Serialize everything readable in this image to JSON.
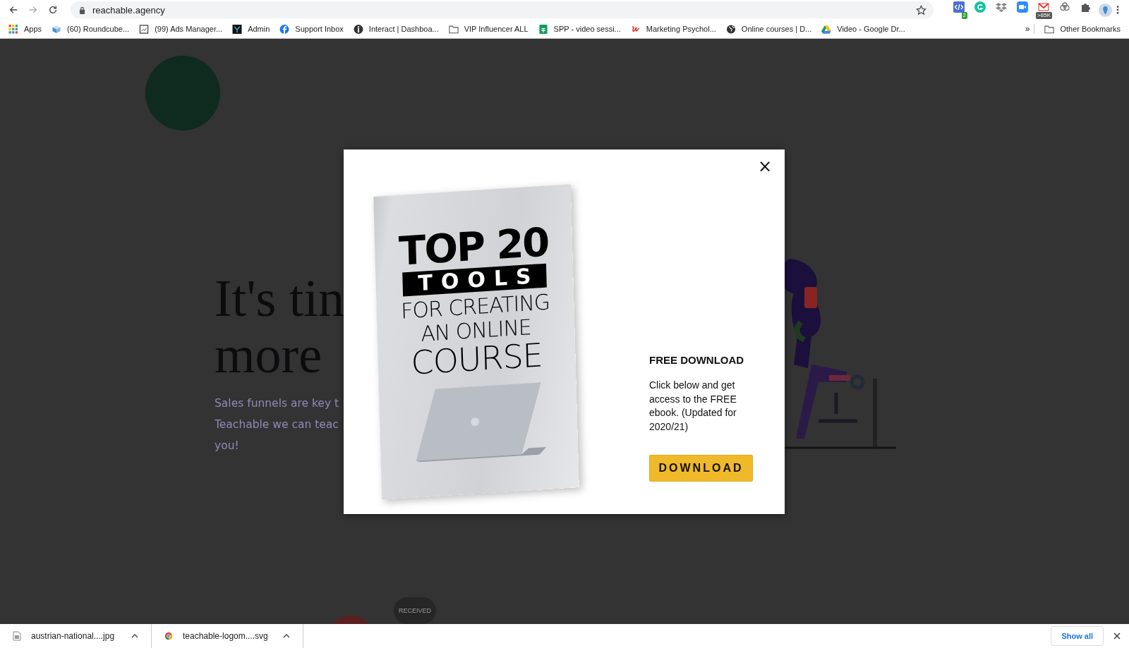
{
  "browser": {
    "url": "reachable.agency",
    "bookmarks": [
      {
        "kind": "apps",
        "label": "Apps"
      },
      {
        "kind": "cube",
        "label": "(60) Roundcube..."
      },
      {
        "kind": "chart",
        "label": "(99) Ads Manager..."
      },
      {
        "kind": "admin",
        "label": "Admin"
      },
      {
        "kind": "facebook",
        "label": "Support Inbox"
      },
      {
        "kind": "interact",
        "label": "Interact | Dashboa..."
      },
      {
        "kind": "folder",
        "label": "VIP Influencer ALL"
      },
      {
        "kind": "sheet",
        "label": "SPP - video sessi..."
      },
      {
        "kind": "letter",
        "label": "Marketing Psychol..."
      },
      {
        "kind": "globe",
        "label": "Online courses | D..."
      },
      {
        "kind": "drive",
        "label": "Video - Google Dr..."
      }
    ],
    "more": "»",
    "other_bookmarks": "Other Bookmarks",
    "extensions": [
      {
        "kind": "code",
        "badge": "2"
      },
      {
        "kind": "grammar"
      },
      {
        "kind": "dropbox"
      },
      {
        "kind": "zoom"
      },
      {
        "kind": "mail",
        "badge": ">85K"
      },
      {
        "kind": "chain"
      },
      {
        "kind": "puzzle"
      }
    ]
  },
  "page": {
    "heading_lines": [
      "It's tin",
      "more"
    ],
    "paragraph_lines": [
      "Sales funnels are key t",
      "Teachable we can teac",
      "you!"
    ],
    "pill": "RECEIVED"
  },
  "modal": {
    "close": "×",
    "cover": {
      "top": "TOP 20",
      "band": "TOOLS",
      "lines": [
        "FOR CREATING",
        "AN ONLINE",
        "COURSE"
      ]
    },
    "title": "FREE DOWNLOAD",
    "body": "Click below and get access to the FREE ebook. (Updated for 2020/21)",
    "button": "DOWNLOAD"
  },
  "downloads": {
    "items": [
      {
        "kind": "image",
        "name": "austrian-national....jpg"
      },
      {
        "kind": "chrome",
        "name": "teachable-logom....svg"
      }
    ],
    "show_all": "Show all"
  }
}
